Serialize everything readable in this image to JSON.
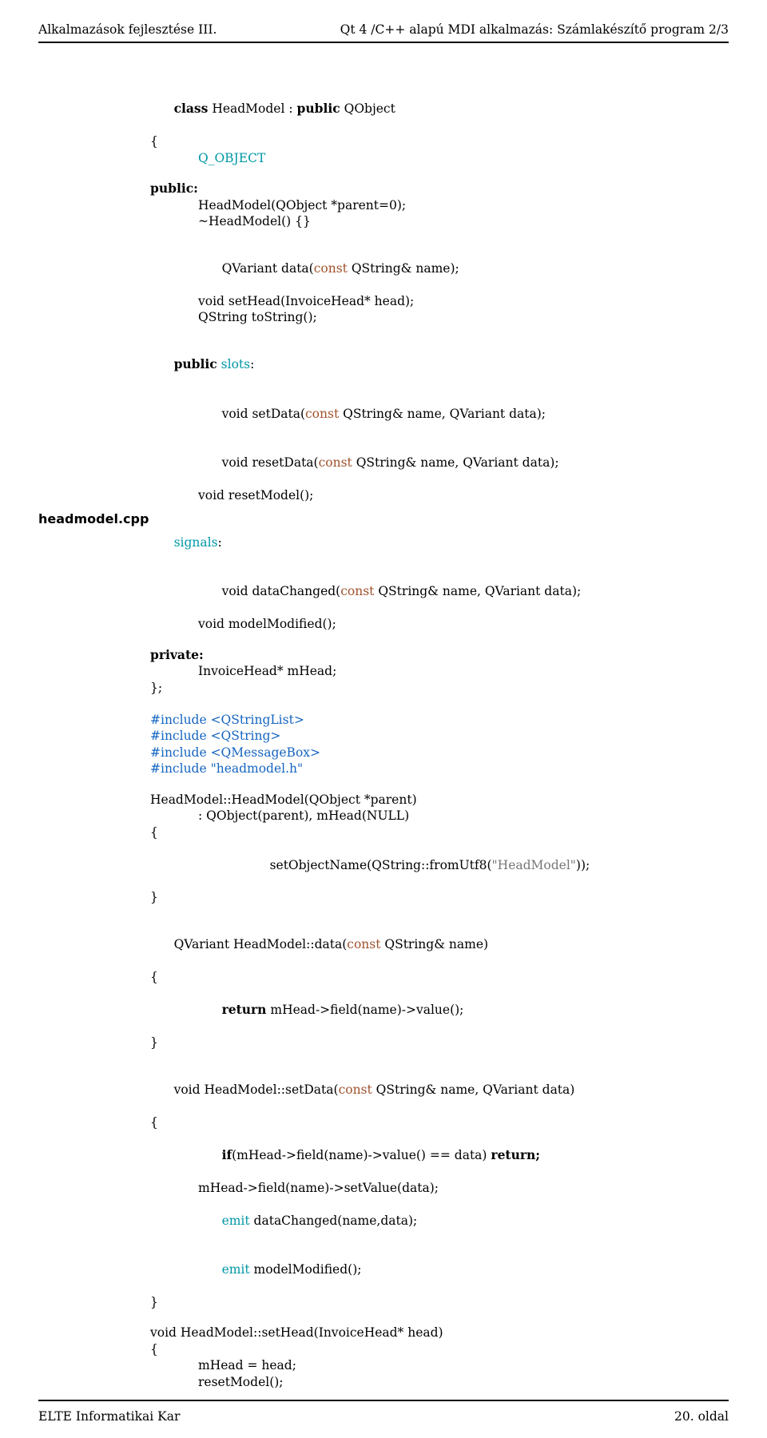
{
  "header": {
    "left": "Alkalmazások fejlesztése III.",
    "right": "Qt 4 /C++ alapú MDI alkalmazás: Számlakészítő program 2/3"
  },
  "footer": {
    "left": "ELTE Informatikai Kar",
    "right": "20. oldal"
  },
  "side": {
    "label": "headmodel.cpp"
  },
  "code": {
    "kw_class": "class",
    "HeadModel": "HeadModel",
    "colon_public": " : ",
    "kw_public": "public",
    "QObject": " QObject",
    "brace_open": "{",
    "q_object": "Q_OBJECT",
    "public_colon": "public:",
    "ctor": "HeadModel(QObject *parent=0);",
    "dtor": "~HeadModel() {}",
    "data_sig_pre": "QVariant data(",
    "const": "const",
    "data_sig_post": " QString& name);",
    "sethead": "void setHead(InvoiceHead* head);",
    "tostring": "QString toString();",
    "public_kw": "public",
    "slots_kw": " slots",
    "colon": ":",
    "setdata_pre": "void setData(",
    "setdata_post": " QString& name, QVariant data);",
    "resetdata_pre": "void resetData(",
    "resetdata_post": " QString& name, QVariant data);",
    "resetmodel": "void resetModel();",
    "signals": "signals",
    "datachanged_pre": "void dataChanged(",
    "datachanged_post": " QString& name, QVariant data);",
    "modelmodified": "void modelModified();",
    "private_colon": "private:",
    "mhead_decl": "InvoiceHead* mHead;",
    "brace_close_semi": "};",
    "inc1": "#include <QStringList>",
    "inc2": "#include <QString>",
    "inc3": "#include <QMessageBox>",
    "inc4_a": "#include ",
    "inc4_b": "\"headmodel.h\"",
    "hm_ctor": "HeadModel::HeadModel(QObject *parent)",
    "hm_ctor_init": ": QObject(parent), mHead(NULL)",
    "brace_open2": "{",
    "setObjName_a": "setObjectName(QString::fromUtf8(",
    "setObjName_b": "\"HeadModel\"",
    "setObjName_c": "));",
    "brace_close": "}",
    "hm_data_pre": "QVariant HeadModel::data(",
    "hm_data_post": " QString& name)",
    "return_kw": "return",
    "hm_data_ret_post": " mHead->field(name)->value();",
    "hm_setdata_pre": "void HeadModel::setData(",
    "hm_setdata_post": " QString& name, QVariant data)",
    "if_kw": "if",
    "hm_setdata_if_post": "(mHead->field(name)->value() == data) ",
    "return_semi": "return;",
    "hm_setdata_ln2": "mHead->field(name)->setValue(data);",
    "emit": "emit",
    "hm_setdata_emit1_post": " dataChanged(name,data);",
    "hm_setdata_emit2_post": " modelModified();",
    "hm_sethead": "void HeadModel::setHead(InvoiceHead* head)",
    "hm_sethead_ln1": "mHead = head;",
    "hm_sethead_ln2": "resetModel();"
  }
}
